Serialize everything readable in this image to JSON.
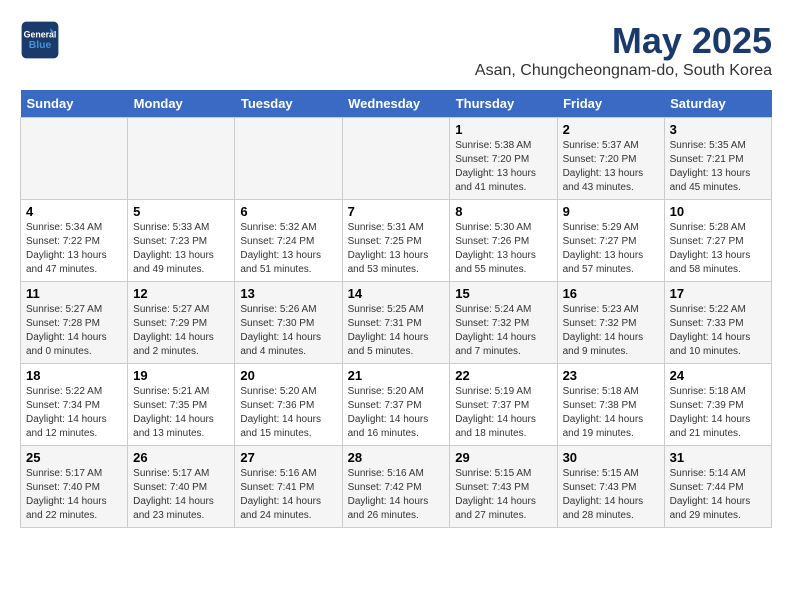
{
  "header": {
    "logo_line1": "General",
    "logo_line2": "Blue",
    "title": "May 2025",
    "subtitle": "Asan, Chungcheongnam-do, South Korea"
  },
  "days_of_week": [
    "Sunday",
    "Monday",
    "Tuesday",
    "Wednesday",
    "Thursday",
    "Friday",
    "Saturday"
  ],
  "weeks": [
    [
      {
        "day": "",
        "info": ""
      },
      {
        "day": "",
        "info": ""
      },
      {
        "day": "",
        "info": ""
      },
      {
        "day": "",
        "info": ""
      },
      {
        "day": "1",
        "info": "Sunrise: 5:38 AM\nSunset: 7:20 PM\nDaylight: 13 hours\nand 41 minutes."
      },
      {
        "day": "2",
        "info": "Sunrise: 5:37 AM\nSunset: 7:20 PM\nDaylight: 13 hours\nand 43 minutes."
      },
      {
        "day": "3",
        "info": "Sunrise: 5:35 AM\nSunset: 7:21 PM\nDaylight: 13 hours\nand 45 minutes."
      }
    ],
    [
      {
        "day": "4",
        "info": "Sunrise: 5:34 AM\nSunset: 7:22 PM\nDaylight: 13 hours\nand 47 minutes."
      },
      {
        "day": "5",
        "info": "Sunrise: 5:33 AM\nSunset: 7:23 PM\nDaylight: 13 hours\nand 49 minutes."
      },
      {
        "day": "6",
        "info": "Sunrise: 5:32 AM\nSunset: 7:24 PM\nDaylight: 13 hours\nand 51 minutes."
      },
      {
        "day": "7",
        "info": "Sunrise: 5:31 AM\nSunset: 7:25 PM\nDaylight: 13 hours\nand 53 minutes."
      },
      {
        "day": "8",
        "info": "Sunrise: 5:30 AM\nSunset: 7:26 PM\nDaylight: 13 hours\nand 55 minutes."
      },
      {
        "day": "9",
        "info": "Sunrise: 5:29 AM\nSunset: 7:27 PM\nDaylight: 13 hours\nand 57 minutes."
      },
      {
        "day": "10",
        "info": "Sunrise: 5:28 AM\nSunset: 7:27 PM\nDaylight: 13 hours\nand 58 minutes."
      }
    ],
    [
      {
        "day": "11",
        "info": "Sunrise: 5:27 AM\nSunset: 7:28 PM\nDaylight: 14 hours\nand 0 minutes."
      },
      {
        "day": "12",
        "info": "Sunrise: 5:27 AM\nSunset: 7:29 PM\nDaylight: 14 hours\nand 2 minutes."
      },
      {
        "day": "13",
        "info": "Sunrise: 5:26 AM\nSunset: 7:30 PM\nDaylight: 14 hours\nand 4 minutes."
      },
      {
        "day": "14",
        "info": "Sunrise: 5:25 AM\nSunset: 7:31 PM\nDaylight: 14 hours\nand 5 minutes."
      },
      {
        "day": "15",
        "info": "Sunrise: 5:24 AM\nSunset: 7:32 PM\nDaylight: 14 hours\nand 7 minutes."
      },
      {
        "day": "16",
        "info": "Sunrise: 5:23 AM\nSunset: 7:32 PM\nDaylight: 14 hours\nand 9 minutes."
      },
      {
        "day": "17",
        "info": "Sunrise: 5:22 AM\nSunset: 7:33 PM\nDaylight: 14 hours\nand 10 minutes."
      }
    ],
    [
      {
        "day": "18",
        "info": "Sunrise: 5:22 AM\nSunset: 7:34 PM\nDaylight: 14 hours\nand 12 minutes."
      },
      {
        "day": "19",
        "info": "Sunrise: 5:21 AM\nSunset: 7:35 PM\nDaylight: 14 hours\nand 13 minutes."
      },
      {
        "day": "20",
        "info": "Sunrise: 5:20 AM\nSunset: 7:36 PM\nDaylight: 14 hours\nand 15 minutes."
      },
      {
        "day": "21",
        "info": "Sunrise: 5:20 AM\nSunset: 7:37 PM\nDaylight: 14 hours\nand 16 minutes."
      },
      {
        "day": "22",
        "info": "Sunrise: 5:19 AM\nSunset: 7:37 PM\nDaylight: 14 hours\nand 18 minutes."
      },
      {
        "day": "23",
        "info": "Sunrise: 5:18 AM\nSunset: 7:38 PM\nDaylight: 14 hours\nand 19 minutes."
      },
      {
        "day": "24",
        "info": "Sunrise: 5:18 AM\nSunset: 7:39 PM\nDaylight: 14 hours\nand 21 minutes."
      }
    ],
    [
      {
        "day": "25",
        "info": "Sunrise: 5:17 AM\nSunset: 7:40 PM\nDaylight: 14 hours\nand 22 minutes."
      },
      {
        "day": "26",
        "info": "Sunrise: 5:17 AM\nSunset: 7:40 PM\nDaylight: 14 hours\nand 23 minutes."
      },
      {
        "day": "27",
        "info": "Sunrise: 5:16 AM\nSunset: 7:41 PM\nDaylight: 14 hours\nand 24 minutes."
      },
      {
        "day": "28",
        "info": "Sunrise: 5:16 AM\nSunset: 7:42 PM\nDaylight: 14 hours\nand 26 minutes."
      },
      {
        "day": "29",
        "info": "Sunrise: 5:15 AM\nSunset: 7:43 PM\nDaylight: 14 hours\nand 27 minutes."
      },
      {
        "day": "30",
        "info": "Sunrise: 5:15 AM\nSunset: 7:43 PM\nDaylight: 14 hours\nand 28 minutes."
      },
      {
        "day": "31",
        "info": "Sunrise: 5:14 AM\nSunset: 7:44 PM\nDaylight: 14 hours\nand 29 minutes."
      }
    ]
  ]
}
